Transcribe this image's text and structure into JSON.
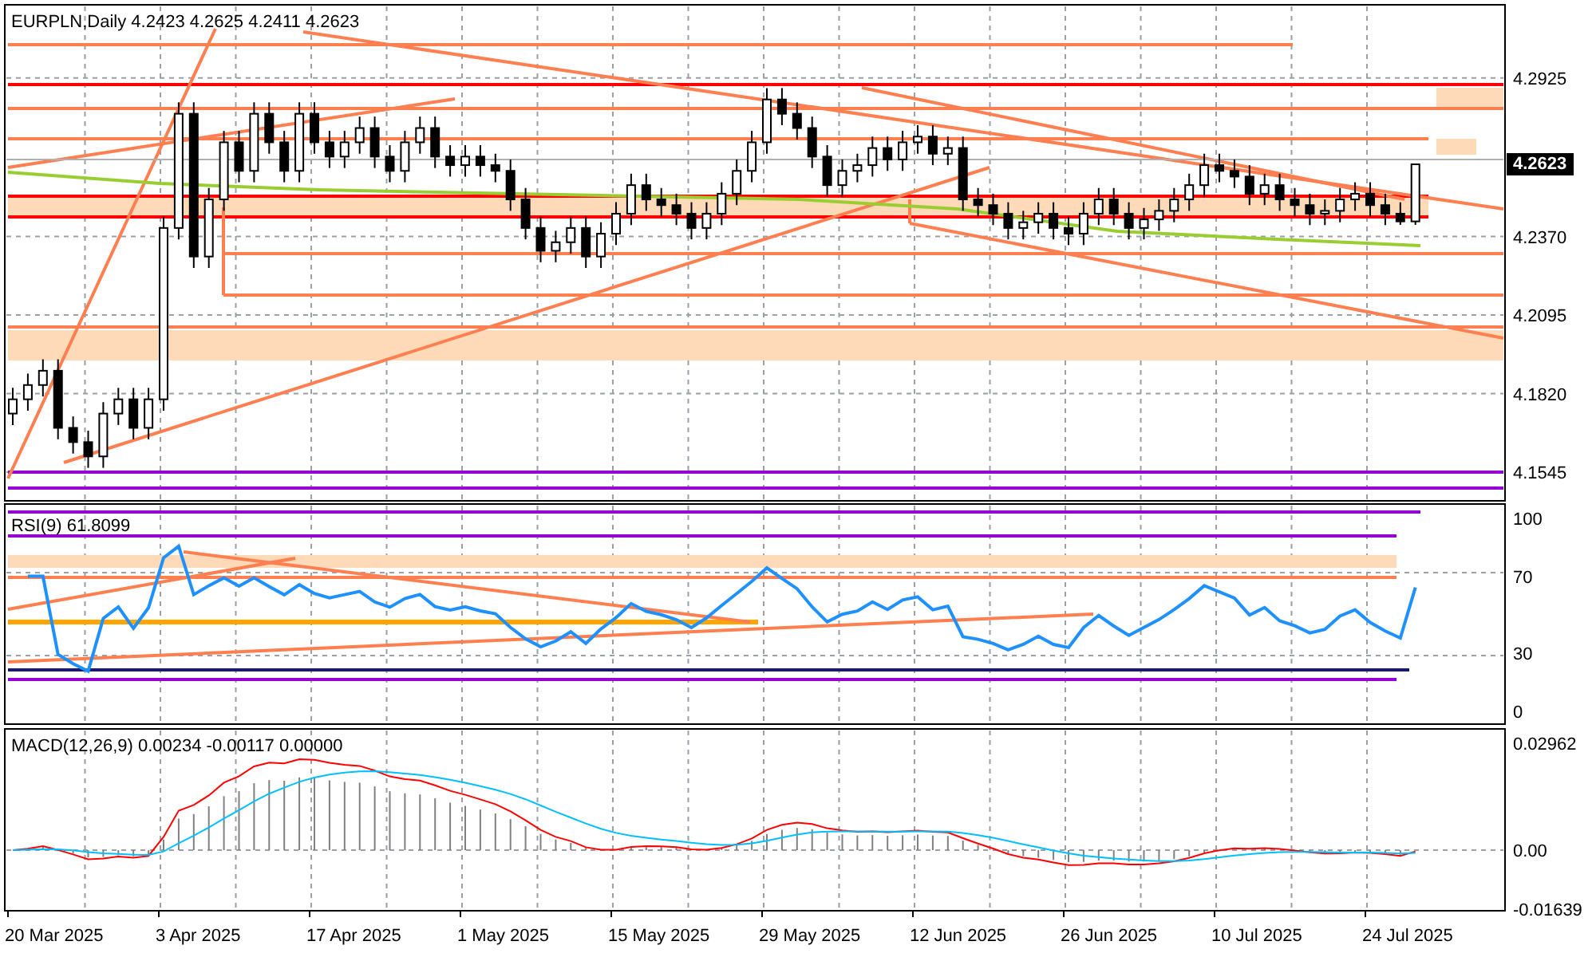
{
  "header": {
    "symbol": "EURPLN,Daily",
    "open": "4.2423",
    "high": "4.2625",
    "low": "4.2411",
    "close": "4.2623"
  },
  "price_chart": {
    "chart_data": {
      "type": "candlestick",
      "ylim": [
        4.145,
        4.3176
      ],
      "ohlc": [
        [
          4.175,
          4.184,
          4.171,
          4.18
        ],
        [
          4.18,
          4.189,
          4.176,
          4.185
        ],
        [
          4.185,
          4.194,
          4.181,
          4.19
        ],
        [
          4.19,
          4.194,
          4.166,
          4.17
        ],
        [
          4.17,
          4.174,
          4.161,
          4.165
        ],
        [
          4.165,
          4.169,
          4.156,
          4.16
        ],
        [
          4.16,
          4.179,
          4.156,
          4.175
        ],
        [
          4.175,
          4.184,
          4.171,
          4.18
        ],
        [
          4.18,
          4.184,
          4.166,
          4.17
        ],
        [
          4.17,
          4.184,
          4.166,
          4.18
        ],
        [
          4.18,
          4.244,
          4.176,
          4.24
        ],
        [
          4.24,
          4.284,
          4.236,
          4.28
        ],
        [
          4.28,
          4.284,
          4.226,
          4.23
        ],
        [
          4.23,
          4.254,
          4.226,
          4.25
        ],
        [
          4.25,
          4.274,
          4.246,
          4.27
        ],
        [
          4.27,
          4.274,
          4.256,
          4.26
        ],
        [
          4.26,
          4.284,
          4.256,
          4.28
        ],
        [
          4.28,
          4.284,
          4.266,
          4.27
        ],
        [
          4.27,
          4.274,
          4.256,
          4.26
        ],
        [
          4.26,
          4.284,
          4.256,
          4.28
        ],
        [
          4.28,
          4.284,
          4.266,
          4.27
        ],
        [
          4.27,
          4.274,
          4.261,
          4.265
        ],
        [
          4.265,
          4.274,
          4.261,
          4.27
        ],
        [
          4.27,
          4.279,
          4.266,
          4.275
        ],
        [
          4.275,
          4.279,
          4.261,
          4.265
        ],
        [
          4.265,
          4.269,
          4.256,
          4.26
        ],
        [
          4.26,
          4.274,
          4.256,
          4.27
        ],
        [
          4.27,
          4.279,
          4.266,
          4.275
        ],
        [
          4.275,
          4.279,
          4.261,
          4.265
        ],
        [
          4.265,
          4.269,
          4.258,
          4.262
        ],
        [
          4.262,
          4.269,
          4.258,
          4.265
        ],
        [
          4.265,
          4.269,
          4.258,
          4.262
        ],
        [
          4.262,
          4.266,
          4.256,
          4.26
        ],
        [
          4.26,
          4.264,
          4.246,
          4.25
        ],
        [
          4.25,
          4.254,
          4.236,
          4.24
        ],
        [
          4.24,
          4.244,
          4.228,
          4.232
        ],
        [
          4.232,
          4.239,
          4.228,
          4.235
        ],
        [
          4.235,
          4.244,
          4.231,
          4.24
        ],
        [
          4.24,
          4.244,
          4.226,
          4.23
        ],
        [
          4.23,
          4.242,
          4.226,
          4.238
        ],
        [
          4.238,
          4.249,
          4.234,
          4.245
        ],
        [
          4.245,
          4.259,
          4.241,
          4.255
        ],
        [
          4.255,
          4.259,
          4.246,
          4.25
        ],
        [
          4.25,
          4.254,
          4.244,
          4.248
        ],
        [
          4.248,
          4.252,
          4.241,
          4.245
        ],
        [
          4.245,
          4.249,
          4.236,
          4.24
        ],
        [
          4.24,
          4.249,
          4.236,
          4.245
        ],
        [
          4.245,
          4.256,
          4.241,
          4.252
        ],
        [
          4.252,
          4.264,
          4.248,
          4.26
        ],
        [
          4.26,
          4.274,
          4.256,
          4.27
        ],
        [
          4.27,
          4.289,
          4.266,
          4.285
        ],
        [
          4.285,
          4.289,
          4.276,
          4.28
        ],
        [
          4.28,
          4.284,
          4.271,
          4.275
        ],
        [
          4.275,
          4.279,
          4.261,
          4.265
        ],
        [
          4.265,
          4.269,
          4.251,
          4.255
        ],
        [
          4.255,
          4.264,
          4.251,
          4.26
        ],
        [
          4.26,
          4.266,
          4.256,
          4.262
        ],
        [
          4.262,
          4.272,
          4.258,
          4.268
        ],
        [
          4.268,
          4.272,
          4.26,
          4.264
        ],
        [
          4.264,
          4.274,
          4.26,
          4.27
        ],
        [
          4.27,
          4.276,
          4.266,
          4.272
        ],
        [
          4.272,
          4.276,
          4.262,
          4.266
        ],
        [
          4.266,
          4.272,
          4.262,
          4.268
        ],
        [
          4.268,
          4.272,
          4.246,
          4.25
        ],
        [
          4.25,
          4.254,
          4.244,
          4.248
        ],
        [
          4.248,
          4.252,
          4.241,
          4.245
        ],
        [
          4.245,
          4.249,
          4.236,
          4.24
        ],
        [
          4.24,
          4.246,
          4.236,
          4.242
        ],
        [
          4.242,
          4.249,
          4.238,
          4.245
        ],
        [
          4.245,
          4.249,
          4.236,
          4.24
        ],
        [
          4.24,
          4.244,
          4.234,
          4.238
        ],
        [
          4.238,
          4.249,
          4.234,
          4.245
        ],
        [
          4.245,
          4.254,
          4.241,
          4.25
        ],
        [
          4.25,
          4.254,
          4.241,
          4.245
        ],
        [
          4.245,
          4.249,
          4.236,
          4.24
        ],
        [
          4.24,
          4.247,
          4.236,
          4.243
        ],
        [
          4.243,
          4.25,
          4.239,
          4.246
        ],
        [
          4.246,
          4.254,
          4.242,
          4.25
        ],
        [
          4.25,
          4.259,
          4.246,
          4.255
        ],
        [
          4.255,
          4.266,
          4.251,
          4.262
        ],
        [
          4.262,
          4.266,
          4.256,
          4.26
        ],
        [
          4.26,
          4.264,
          4.254,
          4.258
        ],
        [
          4.258,
          4.262,
          4.248,
          4.252
        ],
        [
          4.252,
          4.259,
          4.248,
          4.255
        ],
        [
          4.255,
          4.259,
          4.246,
          4.25
        ],
        [
          4.25,
          4.254,
          4.244,
          4.248
        ],
        [
          4.248,
          4.252,
          4.241,
          4.245
        ],
        [
          4.245,
          4.25,
          4.241,
          4.246
        ],
        [
          4.246,
          4.254,
          4.242,
          4.25
        ],
        [
          4.25,
          4.256,
          4.246,
          4.252
        ],
        [
          4.252,
          4.256,
          4.244,
          4.248
        ],
        [
          4.248,
          4.252,
          4.241,
          4.245
        ],
        [
          4.245,
          4.249,
          4.2411,
          4.2423
        ],
        [
          4.2423,
          4.2625,
          4.2411,
          4.2623
        ]
      ],
      "yticks": [
        {
          "value": 4.2925,
          "label": "4.2925"
        },
        {
          "value": 4.237,
          "label": "4.2370"
        },
        {
          "value": 4.2095,
          "label": "4.2095"
        },
        {
          "value": 4.182,
          "label": "4.1820"
        },
        {
          "value": 4.1545,
          "label": "4.1545"
        }
      ]
    },
    "current_price": "4.2623"
  },
  "rsi_panel": {
    "title": "RSI(9) 61.8099",
    "axis_labels": [
      "100",
      "70",
      "30",
      "0"
    ]
  },
  "macd_panel": {
    "title": "MACD(12,26,9) 0.00234 -0.00117 0.00000",
    "axis_labels": [
      "0.02962",
      "0.00",
      "-0.01639"
    ]
  },
  "date_axis": [
    "20 Mar 2025",
    "3 Apr 2025",
    "17 Apr 2025",
    "1 May 2025",
    "15 May 2025",
    "29 May 2025",
    "12 Jun 2025",
    "26 Jun 2025",
    "10 Jul 2025",
    "24 Jul 2025"
  ]
}
